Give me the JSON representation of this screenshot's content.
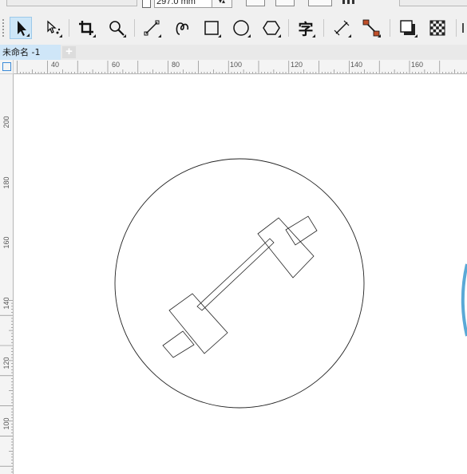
{
  "property_bar": {
    "page_height_value": "297.0 mm"
  },
  "toolbox": {
    "tools": [
      {
        "id": "pick-tool",
        "icon": "pointer-arrow-icon",
        "active": true
      },
      {
        "id": "shape-tool",
        "icon": "shape-node-icon"
      },
      {
        "id": "crop-tool",
        "icon": "crop-icon"
      },
      {
        "id": "zoom-tool",
        "icon": "magnifier-icon"
      },
      {
        "id": "freehand-tool",
        "icon": "freehand-line-icon"
      },
      {
        "id": "artistic-media-tool",
        "icon": "artistic-media-icon"
      },
      {
        "id": "rectangle-tool",
        "icon": "rectangle-icon"
      },
      {
        "id": "ellipse-tool",
        "icon": "ellipse-icon"
      },
      {
        "id": "polygon-tool",
        "icon": "polygon-icon"
      },
      {
        "id": "text-tool",
        "icon": "text-icon",
        "label": "字"
      },
      {
        "id": "parallel-dimension-tool",
        "icon": "dimension-icon"
      },
      {
        "id": "connector-tool",
        "icon": "connector-icon"
      },
      {
        "id": "drop-shadow-tool",
        "icon": "drop-shadow-icon"
      },
      {
        "id": "transparency-tool",
        "icon": "transparency-icon"
      }
    ]
  },
  "document": {
    "tab_label": "未命名 -1",
    "add_tab_label": "+"
  },
  "rulers": {
    "horizontal_labels": [
      "40",
      "60",
      "80",
      "100",
      "120",
      "140",
      "160"
    ],
    "vertical_labels": [
      "200",
      "180",
      "160",
      "140",
      "120",
      "100"
    ]
  },
  "colors": {
    "toolbar_bg": "#f0f0f0",
    "active_tool": "#cde6f7",
    "doc_tab": "#cfe6f8",
    "accent_arc": "#5aa9d6",
    "connector_node": "#c0502a"
  }
}
